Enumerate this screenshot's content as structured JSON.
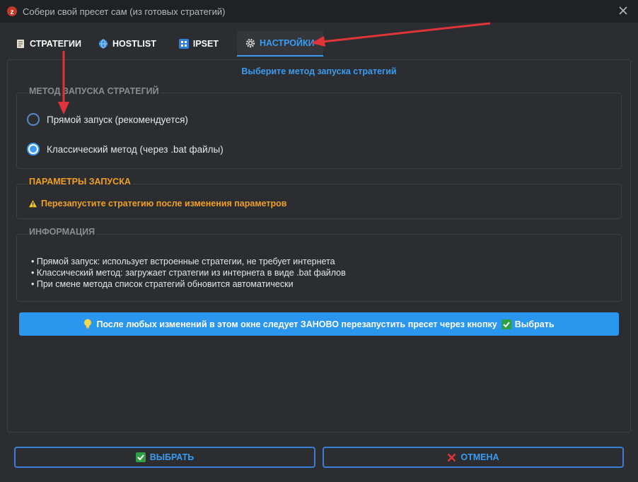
{
  "window": {
    "title": "Собери свой пресет сам (из готовых стратегий)"
  },
  "tabs": [
    {
      "label": "СТРАТЕГИИ",
      "icon": "document-icon"
    },
    {
      "label": "HOSTLIST",
      "icon": "globe-icon"
    },
    {
      "label": "IPSET",
      "icon": "grid-icon"
    },
    {
      "label": "НАСТРОЙКИ",
      "icon": "gear-icon",
      "active": true
    }
  ],
  "panel": {
    "subtitle": "Выберите метод запуска стратегий",
    "launch_method": {
      "title": "МЕТОД ЗАПУСКА СТРАТЕГИЙ",
      "options": [
        {
          "label": "Прямой запуск (рекомендуется)",
          "checked": false
        },
        {
          "label": "Классический метод (через .bat файлы)",
          "checked": true
        }
      ]
    },
    "launch_params": {
      "title": "ПАРАМЕТРЫ ЗАПУСКА",
      "warning": "Перезапустите стратегию после изменения параметров"
    },
    "info": {
      "title": "ИНФОРМАЦИЯ",
      "lines": [
        "• Прямой запуск: использует встроенные стратегии, не требует интернета",
        "• Классический метод: загружает стратегии из интернета в виде .bat файлов",
        "• При смене метода список стратегий обновится автоматически"
      ]
    },
    "banner": {
      "text_before": "После любых изменений в этом окне следует ЗАНОВО перезапустить пресет через кнопку",
      "text_after": "Выбрать"
    }
  },
  "footer": {
    "select_label": "ВЫБРАТЬ",
    "cancel_label": "ОТМЕНА"
  },
  "colors": {
    "accent": "#3a9bf0",
    "warning": "#f0a020",
    "background": "#2b2d30",
    "titlebar": "#202124",
    "annotation_arrow": "#e0343a"
  }
}
